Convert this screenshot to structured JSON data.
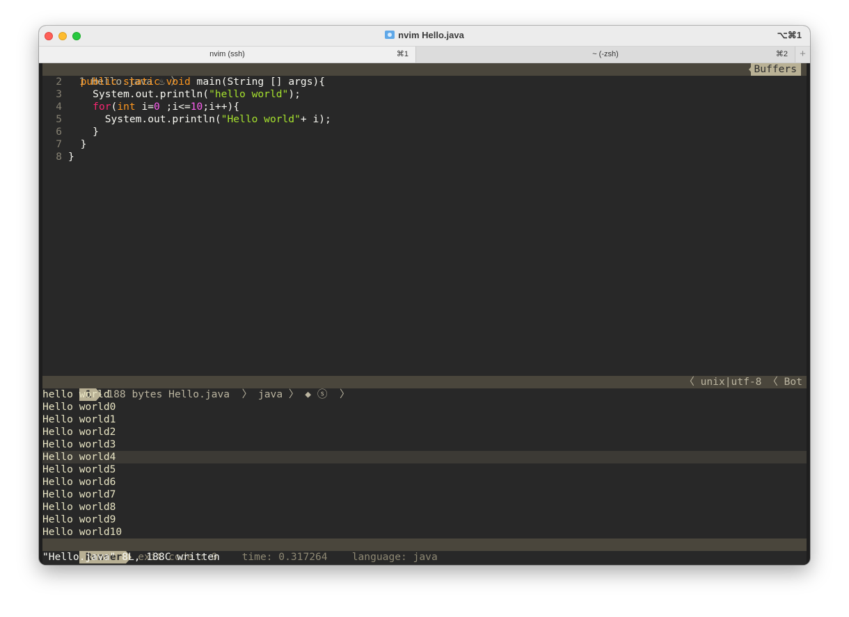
{
  "window": {
    "title": "nvim Hello.java",
    "shortcut": "⌥⌘1"
  },
  "tabs": [
    {
      "label": "nvim (ssh)",
      "shortcut": "⌘1"
    },
    {
      "label": "~ (-zsh)",
      "shortcut": "⌘2"
    }
  ],
  "tab_add_label": "+",
  "vim": {
    "tabline": {
      "buffer": "1 Hello.java ♨ 〉",
      "right_label": "Buffers"
    },
    "code": [
      {
        "n": "2",
        "indent": "  ",
        "parts": [
          {
            "t": "public",
            "c": "kwo"
          },
          {
            "t": " ",
            "c": ""
          },
          {
            "t": "static",
            "c": "kwo"
          },
          {
            "t": " ",
            "c": ""
          },
          {
            "t": "void",
            "c": "kwo"
          },
          {
            "t": " main(String [] args){",
            "c": ""
          }
        ]
      },
      {
        "n": "3",
        "indent": "    ",
        "parts": [
          {
            "t": "System.out.println(",
            "c": ""
          },
          {
            "t": "\"hello world\"",
            "c": "str"
          },
          {
            "t": ");",
            "c": ""
          }
        ]
      },
      {
        "n": "4",
        "indent": "    ",
        "parts": [
          {
            "t": "for",
            "c": "kw"
          },
          {
            "t": "(",
            "c": ""
          },
          {
            "t": "int",
            "c": "kwo"
          },
          {
            "t": " i=",
            "c": ""
          },
          {
            "t": "0",
            "c": "num"
          },
          {
            "t": " ;i<=",
            "c": ""
          },
          {
            "t": "10",
            "c": "num"
          },
          {
            "t": ";i++){",
            "c": ""
          }
        ]
      },
      {
        "n": "5",
        "indent": "      ",
        "parts": [
          {
            "t": "System.out.println(",
            "c": ""
          },
          {
            "t": "\"Hello world\"",
            "c": "str"
          },
          {
            "t": "+ i);",
            "c": ""
          }
        ]
      },
      {
        "n": "6",
        "indent": "    ",
        "parts": [
          {
            "t": "}",
            "c": ""
          }
        ]
      },
      {
        "n": "7",
        "indent": "  ",
        "parts": [
          {
            "t": "}",
            "c": ""
          }
        ]
      },
      {
        "n": "8",
        "indent": "",
        "parts": [
          {
            "t": "}",
            "c": ""
          }
        ]
      }
    ],
    "statusline": {
      "mode": "1",
      "info": " 188 bytes Hello.java  〉 java 〉 ◆ ⓢ  〉",
      "right": "〈 unix|utf-8 〈 Bot"
    },
    "output": [
      "hello world",
      "Hello world0",
      "Hello world1",
      "Hello world2",
      "Hello world3",
      "Hello world4",
      "Hello world5",
      "Hello world6",
      "Hello world7",
      "Hello world8",
      "Hello world9",
      "Hello world10"
    ],
    "highlighted_output_index": 5,
    "runner": {
      "mode": "Runner",
      "info": " exit code : 0    time: 0.317264    language: java"
    },
    "cmdline": "\"Hello.java\" 8L, 188C written"
  },
  "colors": {
    "keyword": "#f92672",
    "type": "#fd971f",
    "string": "#a6e22e",
    "number": "#fd5ff0",
    "background": "#282828",
    "statusline_bg": "#4a463c",
    "mode_bg": "#b9b195"
  }
}
